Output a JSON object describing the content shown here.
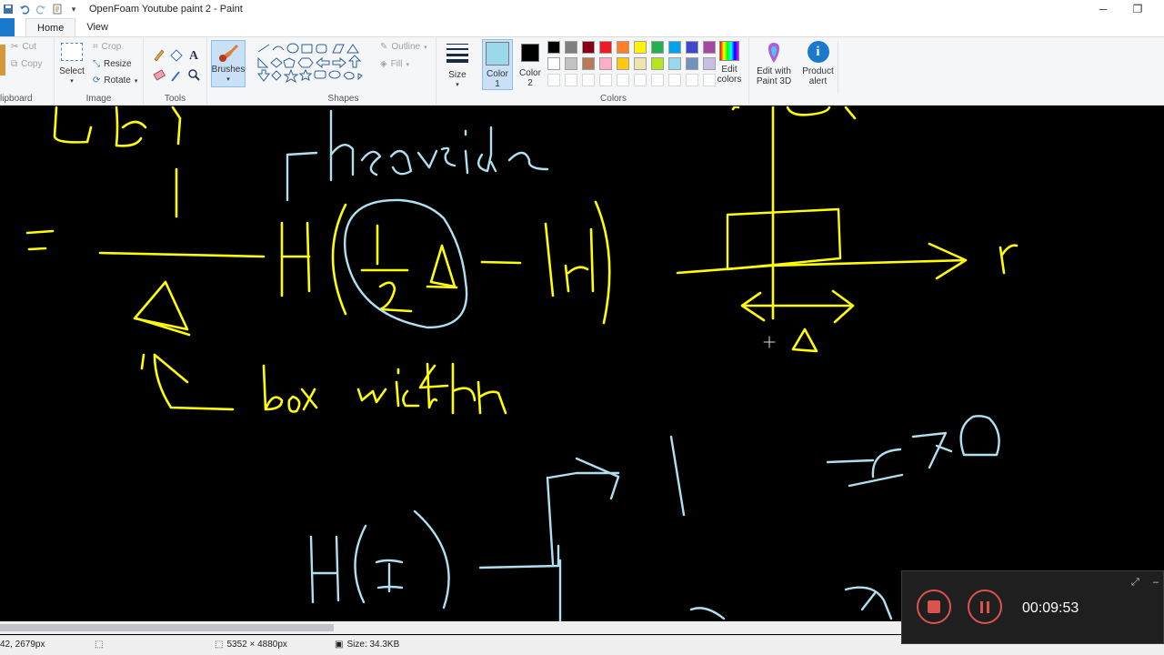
{
  "window": {
    "title": "OpenFoam Youtube paint 2 - Paint",
    "minimize_glyph": "─",
    "restore_glyph": "❐"
  },
  "tabs": [
    {
      "label": "Home",
      "active": true
    },
    {
      "label": "View",
      "active": false
    }
  ],
  "ribbon": {
    "clipboard": {
      "label": "lipboard",
      "cut": "Cut",
      "copy": "Copy"
    },
    "image": {
      "label": "Image",
      "select": "Select",
      "crop": "Crop",
      "resize": "Resize",
      "rotate": "Rotate"
    },
    "tools": {
      "label": "Tools"
    },
    "brushes": {
      "label": "Brushes"
    },
    "shapes": {
      "label": "Shapes",
      "outline": "Outline",
      "fill": "Fill"
    },
    "size": {
      "label": "Size"
    },
    "colors": {
      "label": "Colors",
      "color1": "Color\n1",
      "color1_line1": "Color",
      "color1_line2": "1",
      "color2_line1": "Color",
      "color2_line2": "2",
      "color1_value": "#99d9ea",
      "color2_value": "#000000",
      "palette_row1": [
        "#000000",
        "#7f7f7f",
        "#880015",
        "#ed1c24",
        "#ff7f27",
        "#fff200",
        "#22b14c",
        "#00a2e8",
        "#3f48cc",
        "#a349a4"
      ],
      "palette_row2": [
        "#ffffff",
        "#c3c3c3",
        "#b97a57",
        "#ffaec9",
        "#ffc90e",
        "#efe4b0",
        "#b5e61d",
        "#99d9ea",
        "#7092be",
        "#c8bfe7"
      ],
      "edit_colors_line1": "Edit",
      "edit_colors_line2": "colors"
    },
    "paint3d": {
      "line1": "Edit with",
      "line2": "Paint 3D"
    },
    "product_alert": {
      "line1": "Product",
      "line2": "alert"
    }
  },
  "canvas": {
    "background": "#000000",
    "stroke_yellow": "#ffff00",
    "stroke_blue": "#b0e0f0"
  },
  "status": {
    "cursor_position": "42, 2679px",
    "selection_size": "",
    "image_size": "5352 × 4880px",
    "file_size": "Size: 34.3KB"
  },
  "recorder": {
    "elapsed": "00:09:53"
  }
}
